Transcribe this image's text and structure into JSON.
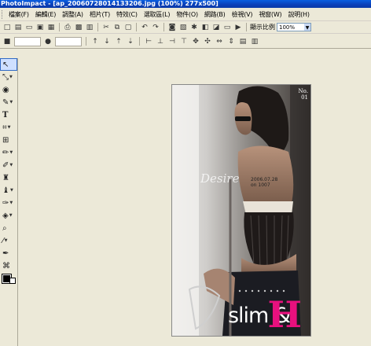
{
  "window": {
    "title": "PhotoImpact - [ap_20060728014133206.jpg (100%) 277x500]"
  },
  "menu": {
    "items": [
      "檔案(F)",
      "編輯(E)",
      "調整(A)",
      "相片(T)",
      "特效(C)",
      "選取區(L)",
      "物件(O)",
      "網路(B)",
      "檢視(V)",
      "視窗(W)",
      "說明(H)"
    ]
  },
  "toolbar": {
    "zoom_label": "顯示比例",
    "zoom_value": "100%",
    "icons": [
      "new-icon",
      "open-icon",
      "open-folder-icon",
      "save-icon",
      "save-as-icon",
      "print-icon",
      "print-preview-icon",
      "scan-icon",
      "cut-icon",
      "copy-icon",
      "paste-icon",
      "undo-icon",
      "redo-icon",
      "camera-icon",
      "image-icon",
      "brightness-icon",
      "adjust-icon",
      "effect-icon",
      "monitor-icon",
      "slideshow-icon"
    ]
  },
  "tools": [
    "pick-tool",
    "transform-tool",
    "lasso-tool",
    "magic-wand-tool",
    "text-tool",
    "crop-tool",
    "frame-tool",
    "paint-brush-tool",
    "airbrush-tool",
    "stamp-tool",
    "eraser-tool",
    "burn-tool",
    "fill-tool",
    "zoom-tool",
    "eyedropper-tool",
    "pen-tool",
    "path-tool",
    "color-swatch"
  ],
  "photo": {
    "issue_label": "No.\n01",
    "overlay_script": "Desire",
    "date_line1": "2006.07.28",
    "date_line2": "on 1007",
    "brand_text": "slim &",
    "brand_letter": "H",
    "accent_color": "#e8107e"
  }
}
